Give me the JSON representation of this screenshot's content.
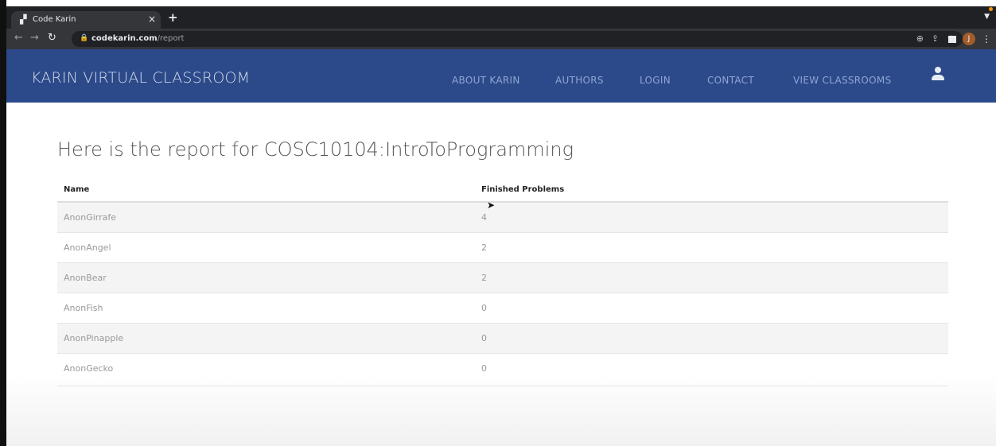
{
  "browser": {
    "tab_title": "Code Karin",
    "close_label": "×",
    "new_tab_label": "+",
    "url_host": "codekarin.com",
    "url_path": "/report",
    "avatar_initial": "J"
  },
  "site": {
    "brand": "KARIN VIRTUAL CLASSROOM",
    "nav": [
      "ABOUT KARIN",
      "AUTHORS",
      "LOGIN",
      "CONTACT",
      "VIEW CLASSROOMS"
    ]
  },
  "report": {
    "title": "Here is the report for COSC10104:IntroToProgramming",
    "columns": [
      "Name",
      "Finished Problems"
    ],
    "rows": [
      {
        "name": "AnonGirrafe",
        "finished": "4"
      },
      {
        "name": "AnonAngel",
        "finished": "2"
      },
      {
        "name": "AnonBear",
        "finished": "2"
      },
      {
        "name": "AnonFish",
        "finished": "0"
      },
      {
        "name": "AnonPinapple",
        "finished": "0"
      },
      {
        "name": "AnonGecko",
        "finished": "0"
      }
    ]
  },
  "colors": {
    "navbar": "#2c4a8a",
    "chrome_dark": "#202124",
    "chrome_toolbar": "#35363a"
  },
  "icons": [
    "tab-favicon-icon",
    "back-icon",
    "forward-icon",
    "reload-icon",
    "lock-icon",
    "zoom-icon",
    "share-icon",
    "bookmark-star-icon",
    "side-panel-icon",
    "more-menu-icon",
    "user-icon"
  ]
}
